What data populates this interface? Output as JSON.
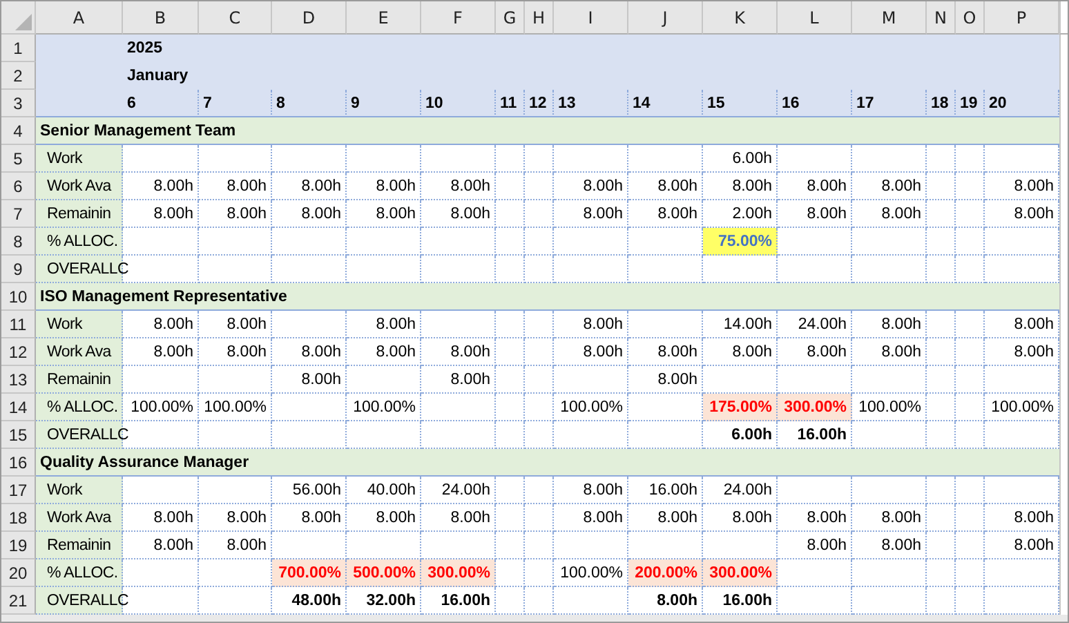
{
  "columns": [
    "A",
    "B",
    "C",
    "D",
    "E",
    "F",
    "G",
    "H",
    "I",
    "J",
    "K",
    "L",
    "M",
    "N",
    "O",
    "P"
  ],
  "rows": [
    {
      "number": "1",
      "kind": "title",
      "cells": [
        {
          "text": "2025",
          "kind": "bold"
        },
        null,
        null,
        null,
        null,
        null,
        null,
        null,
        null,
        null,
        null,
        null,
        null,
        null,
        null
      ]
    },
    {
      "number": "2",
      "kind": "title",
      "cells": [
        {
          "text": "January",
          "kind": "bold"
        },
        null,
        null,
        null,
        null,
        null,
        null,
        null,
        null,
        null,
        null,
        null,
        null,
        null,
        null
      ]
    },
    {
      "number": "3",
      "kind": "date",
      "cells": [
        {
          "text": "6",
          "kind": "bold"
        },
        {
          "text": "7",
          "kind": "bold"
        },
        {
          "text": "8",
          "kind": "bold"
        },
        {
          "text": "9",
          "kind": "bold"
        },
        {
          "text": "10",
          "kind": "bold"
        },
        {
          "text": "11",
          "kind": "bold"
        },
        {
          "text": "12",
          "kind": "bold"
        },
        {
          "text": "13",
          "kind": "bold"
        },
        {
          "text": "14",
          "kind": "bold"
        },
        {
          "text": "15",
          "kind": "bold"
        },
        {
          "text": "16",
          "kind": "bold"
        },
        {
          "text": "17",
          "kind": "bold"
        },
        {
          "text": "18",
          "kind": "bold"
        },
        {
          "text": "19",
          "kind": "bold"
        },
        {
          "text": "20",
          "kind": "bold"
        }
      ]
    },
    {
      "number": "4",
      "kind": "group",
      "label": "Senior Management Team"
    },
    {
      "number": "5",
      "kind": "field",
      "label": "Work",
      "cells": [
        null,
        null,
        null,
        null,
        null,
        null,
        null,
        null,
        null,
        {
          "text": "6.00h",
          "kind": "plain"
        },
        null,
        null,
        null,
        null,
        null
      ]
    },
    {
      "number": "6",
      "kind": "field",
      "label": "Work Ava",
      "cells": [
        {
          "text": "8.00h",
          "kind": "plain"
        },
        {
          "text": "8.00h",
          "kind": "plain"
        },
        {
          "text": "8.00h",
          "kind": "plain"
        },
        {
          "text": "8.00h",
          "kind": "plain"
        },
        {
          "text": "8.00h",
          "kind": "plain"
        },
        null,
        null,
        {
          "text": "8.00h",
          "kind": "plain"
        },
        {
          "text": "8.00h",
          "kind": "plain"
        },
        {
          "text": "8.00h",
          "kind": "plain"
        },
        {
          "text": "8.00h",
          "kind": "plain"
        },
        {
          "text": "8.00h",
          "kind": "plain"
        },
        null,
        null,
        {
          "text": "8.00h",
          "kind": "plain"
        }
      ]
    },
    {
      "number": "7",
      "kind": "field",
      "label": "Remainin",
      "cells": [
        {
          "text": "8.00h",
          "kind": "plain"
        },
        {
          "text": "8.00h",
          "kind": "plain"
        },
        {
          "text": "8.00h",
          "kind": "plain"
        },
        {
          "text": "8.00h",
          "kind": "plain"
        },
        {
          "text": "8.00h",
          "kind": "plain"
        },
        null,
        null,
        {
          "text": "8.00h",
          "kind": "plain"
        },
        {
          "text": "8.00h",
          "kind": "plain"
        },
        {
          "text": "2.00h",
          "kind": "plain"
        },
        {
          "text": "8.00h",
          "kind": "plain"
        },
        {
          "text": "8.00h",
          "kind": "plain"
        },
        null,
        null,
        {
          "text": "8.00h",
          "kind": "plain"
        }
      ]
    },
    {
      "number": "8",
      "kind": "field",
      "label": "% ALLOC.",
      "cells": [
        null,
        null,
        null,
        null,
        null,
        null,
        null,
        null,
        null,
        {
          "text": "75.00%",
          "kind": "under"
        },
        null,
        null,
        null,
        null,
        null
      ]
    },
    {
      "number": "9",
      "kind": "field",
      "label": "OVERALLC",
      "cells": [
        null,
        null,
        null,
        null,
        null,
        null,
        null,
        null,
        null,
        null,
        null,
        null,
        null,
        null,
        null
      ]
    },
    {
      "number": "10",
      "kind": "group",
      "label": "ISO Management Representative"
    },
    {
      "number": "11",
      "kind": "field",
      "label": "Work",
      "cells": [
        {
          "text": "8.00h",
          "kind": "plain"
        },
        {
          "text": "8.00h",
          "kind": "plain"
        },
        null,
        {
          "text": "8.00h",
          "kind": "plain"
        },
        null,
        null,
        null,
        {
          "text": "8.00h",
          "kind": "plain"
        },
        null,
        {
          "text": "14.00h",
          "kind": "plain"
        },
        {
          "text": "24.00h",
          "kind": "plain"
        },
        {
          "text": "8.00h",
          "kind": "plain"
        },
        null,
        null,
        {
          "text": "8.00h",
          "kind": "plain"
        }
      ]
    },
    {
      "number": "12",
      "kind": "field",
      "label": "Work Ava",
      "cells": [
        {
          "text": "8.00h",
          "kind": "plain"
        },
        {
          "text": "8.00h",
          "kind": "plain"
        },
        {
          "text": "8.00h",
          "kind": "plain"
        },
        {
          "text": "8.00h",
          "kind": "plain"
        },
        {
          "text": "8.00h",
          "kind": "plain"
        },
        null,
        null,
        {
          "text": "8.00h",
          "kind": "plain"
        },
        {
          "text": "8.00h",
          "kind": "plain"
        },
        {
          "text": "8.00h",
          "kind": "plain"
        },
        {
          "text": "8.00h",
          "kind": "plain"
        },
        {
          "text": "8.00h",
          "kind": "plain"
        },
        null,
        null,
        {
          "text": "8.00h",
          "kind": "plain"
        }
      ]
    },
    {
      "number": "13",
      "kind": "field",
      "label": "Remainin",
      "cells": [
        null,
        null,
        {
          "text": "8.00h",
          "kind": "plain"
        },
        null,
        {
          "text": "8.00h",
          "kind": "plain"
        },
        null,
        null,
        null,
        {
          "text": "8.00h",
          "kind": "plain"
        },
        null,
        null,
        null,
        null,
        null,
        null
      ]
    },
    {
      "number": "14",
      "kind": "field",
      "label": "% ALLOC.",
      "cells": [
        {
          "text": "100.00%",
          "kind": "plain"
        },
        {
          "text": "100.00%",
          "kind": "plain"
        },
        null,
        {
          "text": "100.00%",
          "kind": "plain"
        },
        null,
        null,
        null,
        {
          "text": "100.00%",
          "kind": "plain"
        },
        null,
        {
          "text": "175.00%",
          "kind": "over"
        },
        {
          "text": "300.00%",
          "kind": "over"
        },
        {
          "text": "100.00%",
          "kind": "plain"
        },
        null,
        null,
        {
          "text": "100.00%",
          "kind": "plain"
        }
      ]
    },
    {
      "number": "15",
      "kind": "field",
      "label": "OVERALLC",
      "cells": [
        null,
        null,
        null,
        null,
        null,
        null,
        null,
        null,
        null,
        {
          "text": "6.00h",
          "kind": "bold"
        },
        {
          "text": "16.00h",
          "kind": "bold"
        },
        null,
        null,
        null,
        null
      ]
    },
    {
      "number": "16",
      "kind": "group",
      "label": "Quality Assurance Manager"
    },
    {
      "number": "17",
      "kind": "field",
      "label": "Work",
      "cells": [
        null,
        null,
        {
          "text": "56.00h",
          "kind": "plain"
        },
        {
          "text": "40.00h",
          "kind": "plain"
        },
        {
          "text": "24.00h",
          "kind": "plain"
        },
        null,
        null,
        {
          "text": "8.00h",
          "kind": "plain"
        },
        {
          "text": "16.00h",
          "kind": "plain"
        },
        {
          "text": "24.00h",
          "kind": "plain"
        },
        null,
        null,
        null,
        null,
        null
      ]
    },
    {
      "number": "18",
      "kind": "field",
      "label": "Work Ava",
      "cells": [
        {
          "text": "8.00h",
          "kind": "plain"
        },
        {
          "text": "8.00h",
          "kind": "plain"
        },
        {
          "text": "8.00h",
          "kind": "plain"
        },
        {
          "text": "8.00h",
          "kind": "plain"
        },
        {
          "text": "8.00h",
          "kind": "plain"
        },
        null,
        null,
        {
          "text": "8.00h",
          "kind": "plain"
        },
        {
          "text": "8.00h",
          "kind": "plain"
        },
        {
          "text": "8.00h",
          "kind": "plain"
        },
        {
          "text": "8.00h",
          "kind": "plain"
        },
        {
          "text": "8.00h",
          "kind": "plain"
        },
        null,
        null,
        {
          "text": "8.00h",
          "kind": "plain"
        }
      ]
    },
    {
      "number": "19",
      "kind": "field",
      "label": "Remainin",
      "cells": [
        {
          "text": "8.00h",
          "kind": "plain"
        },
        {
          "text": "8.00h",
          "kind": "plain"
        },
        null,
        null,
        null,
        null,
        null,
        null,
        null,
        null,
        {
          "text": "8.00h",
          "kind": "plain"
        },
        {
          "text": "8.00h",
          "kind": "plain"
        },
        null,
        null,
        {
          "text": "8.00h",
          "kind": "plain"
        }
      ]
    },
    {
      "number": "20",
      "kind": "field",
      "label": "% ALLOC.",
      "cells": [
        null,
        null,
        {
          "text": "700.00%",
          "kind": "over"
        },
        {
          "text": "500.00%",
          "kind": "over"
        },
        {
          "text": "300.00%",
          "kind": "over"
        },
        null,
        null,
        {
          "text": "100.00%",
          "kind": "plain"
        },
        {
          "text": "200.00%",
          "kind": "over"
        },
        {
          "text": "300.00%",
          "kind": "over"
        },
        null,
        null,
        null,
        null,
        null
      ]
    },
    {
      "number": "21",
      "kind": "field",
      "label": "OVERALLC",
      "cells": [
        null,
        null,
        {
          "text": "48.00h",
          "kind": "bold"
        },
        {
          "text": "32.00h",
          "kind": "bold"
        },
        {
          "text": "16.00h",
          "kind": "bold"
        },
        null,
        null,
        null,
        {
          "text": "8.00h",
          "kind": "bold"
        },
        {
          "text": "16.00h",
          "kind": "bold"
        },
        null,
        null,
        null,
        null,
        null
      ]
    }
  ]
}
